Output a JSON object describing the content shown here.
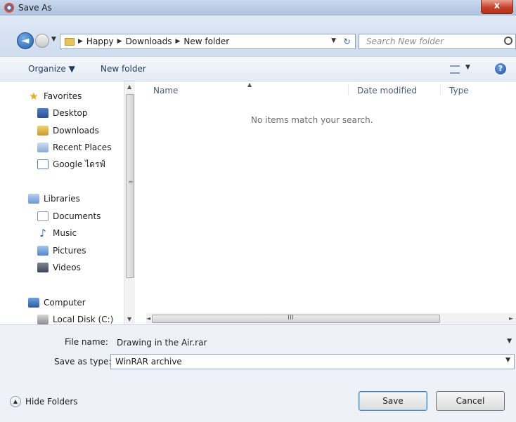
{
  "window": {
    "title": "Save As",
    "close_label": "x"
  },
  "address": {
    "crumbs": [
      "Happy",
      "Downloads",
      "New folder"
    ],
    "search_placeholder": "Search New folder"
  },
  "toolbar": {
    "organize_label": "Organize ▼",
    "new_folder_label": "New folder",
    "help_label": "?"
  },
  "sidebar": {
    "favorites": {
      "label": "Favorites",
      "items": [
        {
          "label": "Desktop",
          "icon": "desktop-icon"
        },
        {
          "label": "Downloads",
          "icon": "downloads-icon"
        },
        {
          "label": "Recent Places",
          "icon": "recent-places-icon"
        },
        {
          "label": "Google ไดรฟ์",
          "icon": "google-drive-icon"
        }
      ]
    },
    "libraries": {
      "label": "Libraries",
      "items": [
        {
          "label": "Documents",
          "icon": "documents-icon"
        },
        {
          "label": "Music",
          "icon": "music-icon"
        },
        {
          "label": "Pictures",
          "icon": "pictures-icon"
        },
        {
          "label": "Videos",
          "icon": "videos-icon"
        }
      ]
    },
    "computer": {
      "label": "Computer",
      "items": [
        {
          "label": "Local Disk (C:)",
          "icon": "local-disk-icon"
        }
      ]
    }
  },
  "file_list": {
    "columns": [
      "Name",
      "Date modified",
      "Type"
    ],
    "empty_message": "No items match your search."
  },
  "form": {
    "file_name_label": "File name:",
    "file_name_value": "Drawing in the Air.rar",
    "save_type_label": "Save as type:",
    "save_type_value": "WinRAR archive"
  },
  "buttons": {
    "save": "Save",
    "cancel": "Cancel",
    "hide_folders": "Hide Folders"
  },
  "hscroll_grip": "III",
  "vscroll_grip": "="
}
